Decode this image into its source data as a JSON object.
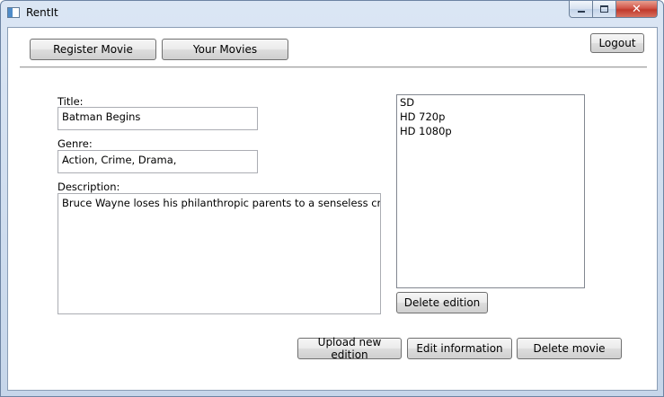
{
  "window": {
    "title": "RentIt"
  },
  "nav": {
    "register_movie_label": "Register Movie",
    "your_movies_label": "Your Movies",
    "logout_label": "Logout"
  },
  "form": {
    "title_label": "Title:",
    "title_value": "Batman Begins",
    "genre_label": "Genre:",
    "genre_value": "Action, Crime, Drama,",
    "description_label": "Description:",
    "description_value": "Bruce Wayne loses his philanthropic parents to a senseless crime, a"
  },
  "editions": {
    "items": [
      "SD",
      "HD 720p",
      "HD 1080p"
    ],
    "delete_label": "Delete edition"
  },
  "actions": {
    "upload_label": "Upload new edition",
    "edit_label": "Edit information",
    "delete_movie_label": "Delete movie"
  }
}
